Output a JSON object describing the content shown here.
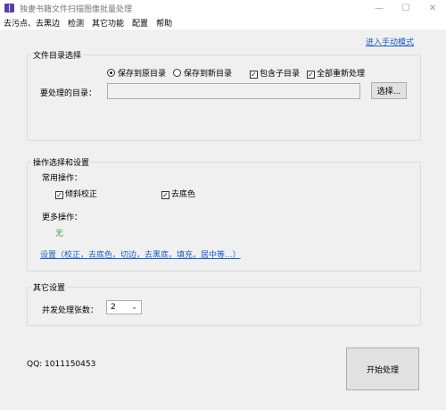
{
  "window": {
    "title": "独妻书籍文件扫描图像批量处理",
    "minimize_glyph": "—",
    "maximize_glyph": "☐",
    "close_glyph": "✕"
  },
  "menu": {
    "items": [
      "去污点、去黑边",
      "检测",
      "其它功能",
      "配置",
      "帮助"
    ]
  },
  "manual_mode_link": "进入手动模式",
  "file_group": {
    "title": "文件目录选择",
    "radio_save_original": "保存到原目录",
    "radio_save_new": "保存到新目录",
    "radio_selected": "save_original",
    "check_include_subdirs": "包含子目录",
    "check_include_subdirs_checked": true,
    "check_reprocess_all": "全部重新处理",
    "check_reprocess_all_checked": true,
    "dir_label": "要处理的目录：",
    "dir_value": "",
    "browse_button": "选择..."
  },
  "ops_group": {
    "title": "操作选择和设置",
    "common_label": "常用操作：",
    "check_deskew": "倾斜校正",
    "check_deskew_checked": true,
    "check_remove_bg": "去底色",
    "check_remove_bg_checked": true,
    "more_label": "更多操作：",
    "more_value": "无",
    "more_value_color": "#2ea043",
    "settings_link": "设置（校正，去底色，切边，去黑底，填充，居中等...）"
  },
  "other_group": {
    "title": "其它设置",
    "concurrency_label": "并发处理张数：",
    "concurrency_value": "2"
  },
  "qq_text": "QQ: 1011150453",
  "start_button": "开始处理",
  "colors": {
    "link": "#1b5cc7",
    "background": "#f0f0f0",
    "app_icon": "#5a3fa8"
  }
}
